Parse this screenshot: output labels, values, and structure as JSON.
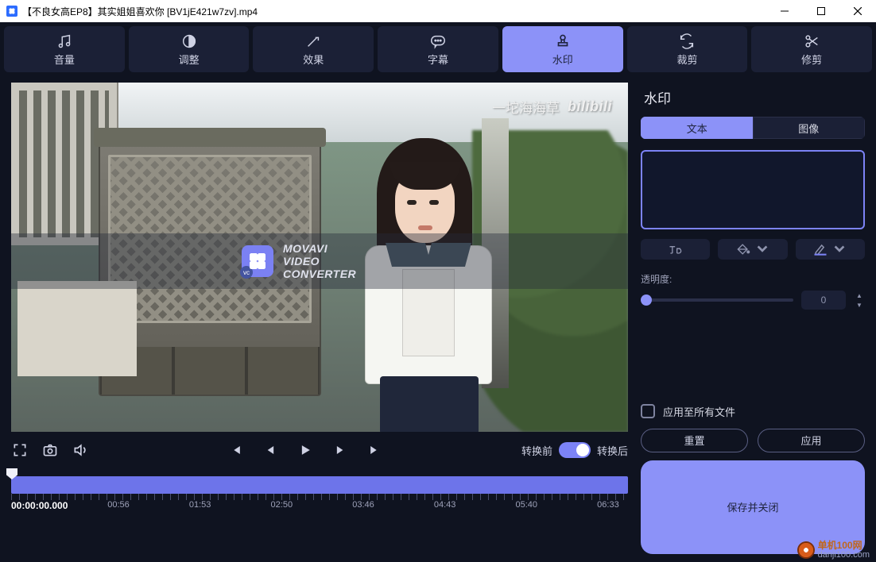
{
  "titlebar": {
    "title": "【不良女高EP8】其实姐姐喜欢你 [BV1jE421w7zv].mp4"
  },
  "toolbar": {
    "volume": "音量",
    "adjust": "调整",
    "effects": "效果",
    "subtitle": "字幕",
    "watermark": "水印",
    "crop": "裁剪",
    "trim": "修剪"
  },
  "preview": {
    "logo_line1": "MOVAVI",
    "logo_line2": "VIDEO",
    "logo_line3": "CONVERTER",
    "vc": "vc",
    "corner_text": "一坨海海草",
    "corner_brand": "bilibili"
  },
  "controls": {
    "before": "转换前",
    "after": "转换后"
  },
  "timeline": {
    "timecode": "00:00:00.000",
    "ticks": [
      "00:56",
      "01:53",
      "02:50",
      "03:46",
      "04:43",
      "05:40",
      "06:33"
    ]
  },
  "side": {
    "heading": "水印",
    "tab_text": "文本",
    "tab_image": "图像",
    "textarea_value": "",
    "opacity_label": "透明度:",
    "opacity_value": "0",
    "apply_all": "应用至所有文件",
    "reset": "重置",
    "apply": "应用",
    "save_close": "保存并关闭"
  },
  "footer_badge": "单机100网\ndanji100.com"
}
